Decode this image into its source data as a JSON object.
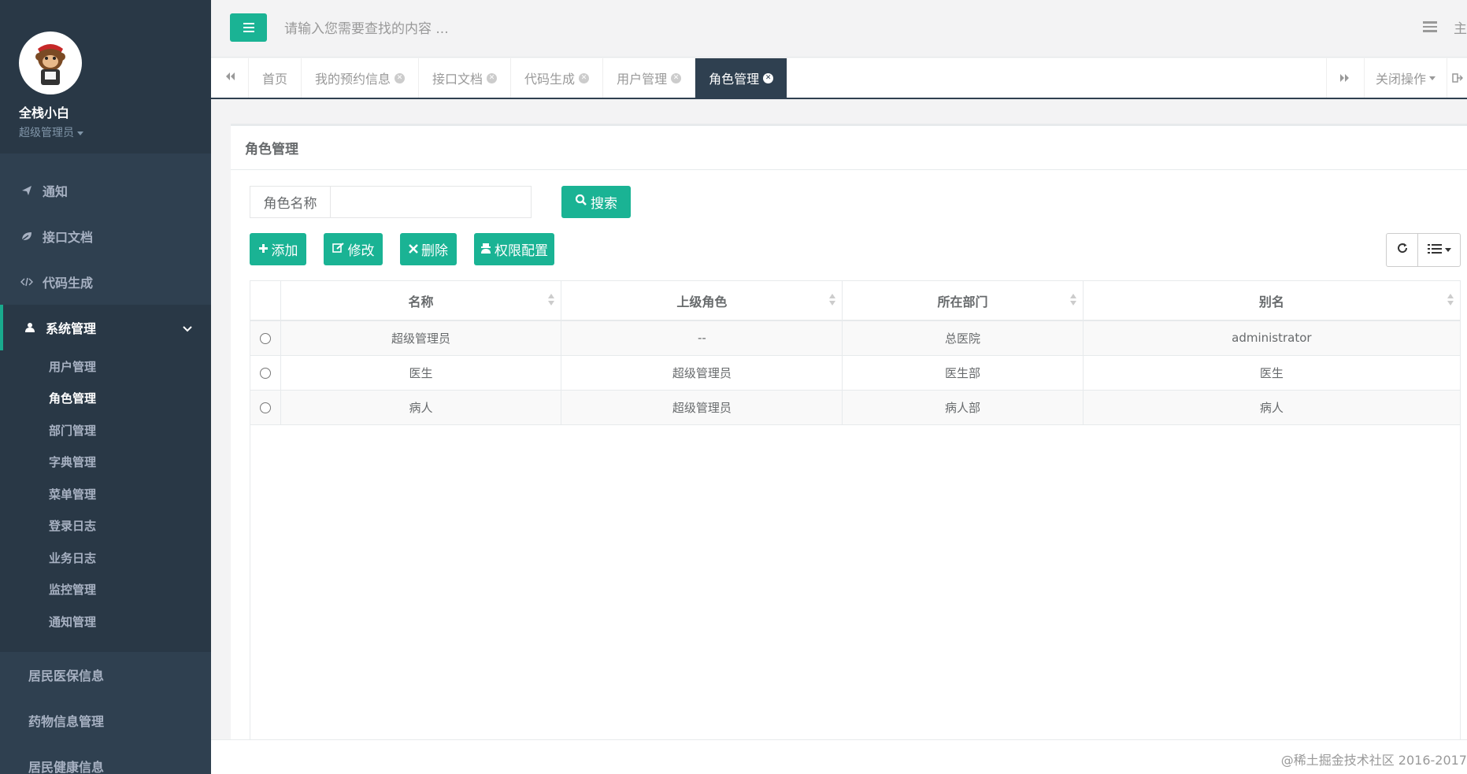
{
  "profile": {
    "name": "全栈小白",
    "role": "超级管理员"
  },
  "sidebar": {
    "items": [
      {
        "label": "通知",
        "icon": "paper-plane-icon"
      },
      {
        "label": "接口文档",
        "icon": "leaf-icon"
      },
      {
        "label": "代码生成",
        "icon": "code-icon"
      }
    ],
    "active": {
      "label": "系统管理",
      "icon": "user-icon"
    },
    "subitems": [
      "用户管理",
      "角色管理",
      "部门管理",
      "字典管理",
      "菜单管理",
      "登录日志",
      "业务日志",
      "监控管理",
      "通知管理"
    ],
    "current_sub": "角色管理",
    "bottom": [
      "居民医保信息",
      "药物信息管理",
      "居民健康信息"
    ]
  },
  "topbar": {
    "search_placeholder": "请输入您需要查找的内容 ...",
    "right_text": "主"
  },
  "tabs": {
    "items": [
      {
        "label": "首页",
        "closable": false
      },
      {
        "label": "我的预约信息",
        "closable": true
      },
      {
        "label": "接口文档",
        "closable": true
      },
      {
        "label": "代码生成",
        "closable": true
      },
      {
        "label": "用户管理",
        "closable": true
      },
      {
        "label": "角色管理",
        "closable": true,
        "active": true
      }
    ],
    "close_ops": "关闭操作"
  },
  "content": {
    "title": "角色管理",
    "search_label": "角色名称",
    "search_value": "",
    "search_button": "搜索",
    "buttons": {
      "add": "添加",
      "edit": "修改",
      "delete": "删除",
      "perm": "权限配置"
    }
  },
  "table": {
    "columns": [
      "名称",
      "上级角色",
      "所在部门",
      "别名"
    ],
    "rows": [
      [
        "超级管理员",
        "--",
        "总医院",
        "administrator"
      ],
      [
        "医生",
        "超级管理员",
        "医生部",
        "医生"
      ],
      [
        "病人",
        "超级管理员",
        "病人部",
        "病人"
      ]
    ]
  },
  "footer": {
    "text": "@稀土掘金技术社区 2016-2017"
  },
  "colors": {
    "sidebar": "#2f4050",
    "accent": "#1ab394"
  }
}
